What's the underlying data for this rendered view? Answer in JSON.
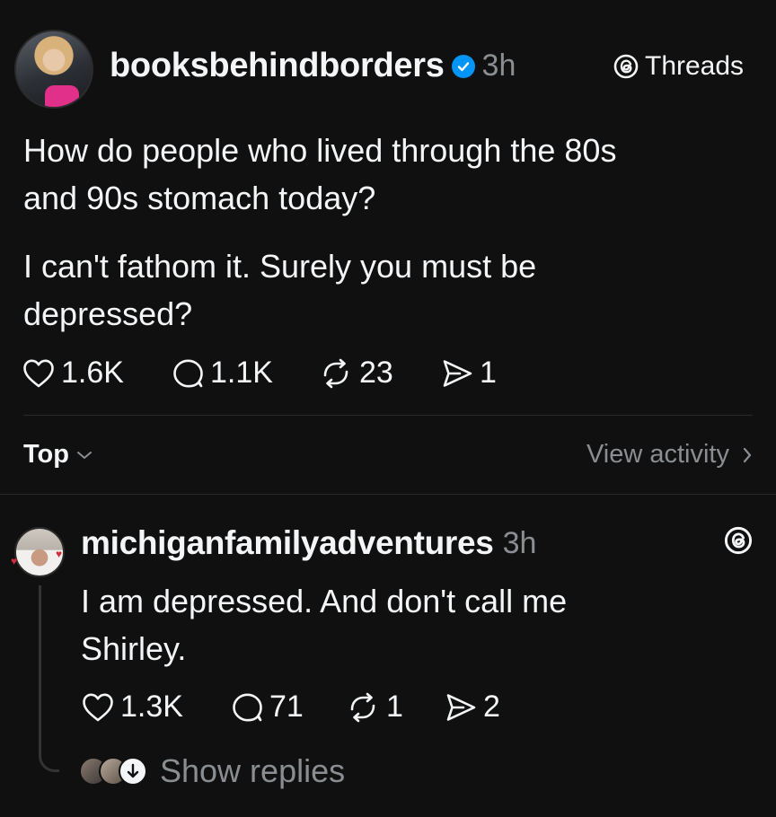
{
  "post": {
    "username": "booksbehindborders",
    "timestamp": "3h",
    "threads_label": "Threads",
    "paragraph1_line1": "How do people who lived through the 80s",
    "paragraph1_line2": "and 90s stomach today?",
    "paragraph2_line1": "I can't fathom it. Surely you must be",
    "paragraph2_line2": "depressed?",
    "stats": {
      "likes": "1.6K",
      "replies": "1.1K",
      "reposts": "23",
      "shares": "1"
    }
  },
  "sort_bar": {
    "sort_label": "Top",
    "view_activity_label": "View activity"
  },
  "reply": {
    "username": "michiganfamilyadventures",
    "timestamp": "3h",
    "line1": "I am depressed. And don't call me",
    "line2": "Shirley.",
    "stats": {
      "likes": "1.3K",
      "replies": "71",
      "reposts": "1",
      "shares": "2"
    },
    "show_replies_label": "Show replies"
  },
  "colors": {
    "background": "#101010",
    "text": "#f3f5f7",
    "muted": "#8a8d91",
    "verified": "#0095f6"
  },
  "icons": [
    "verified-badge-icon",
    "threads-logo-icon",
    "heart-icon",
    "comment-icon",
    "repost-icon",
    "send-icon",
    "chevron-down-icon",
    "chevron-right-icon",
    "arrow-down-icon"
  ]
}
